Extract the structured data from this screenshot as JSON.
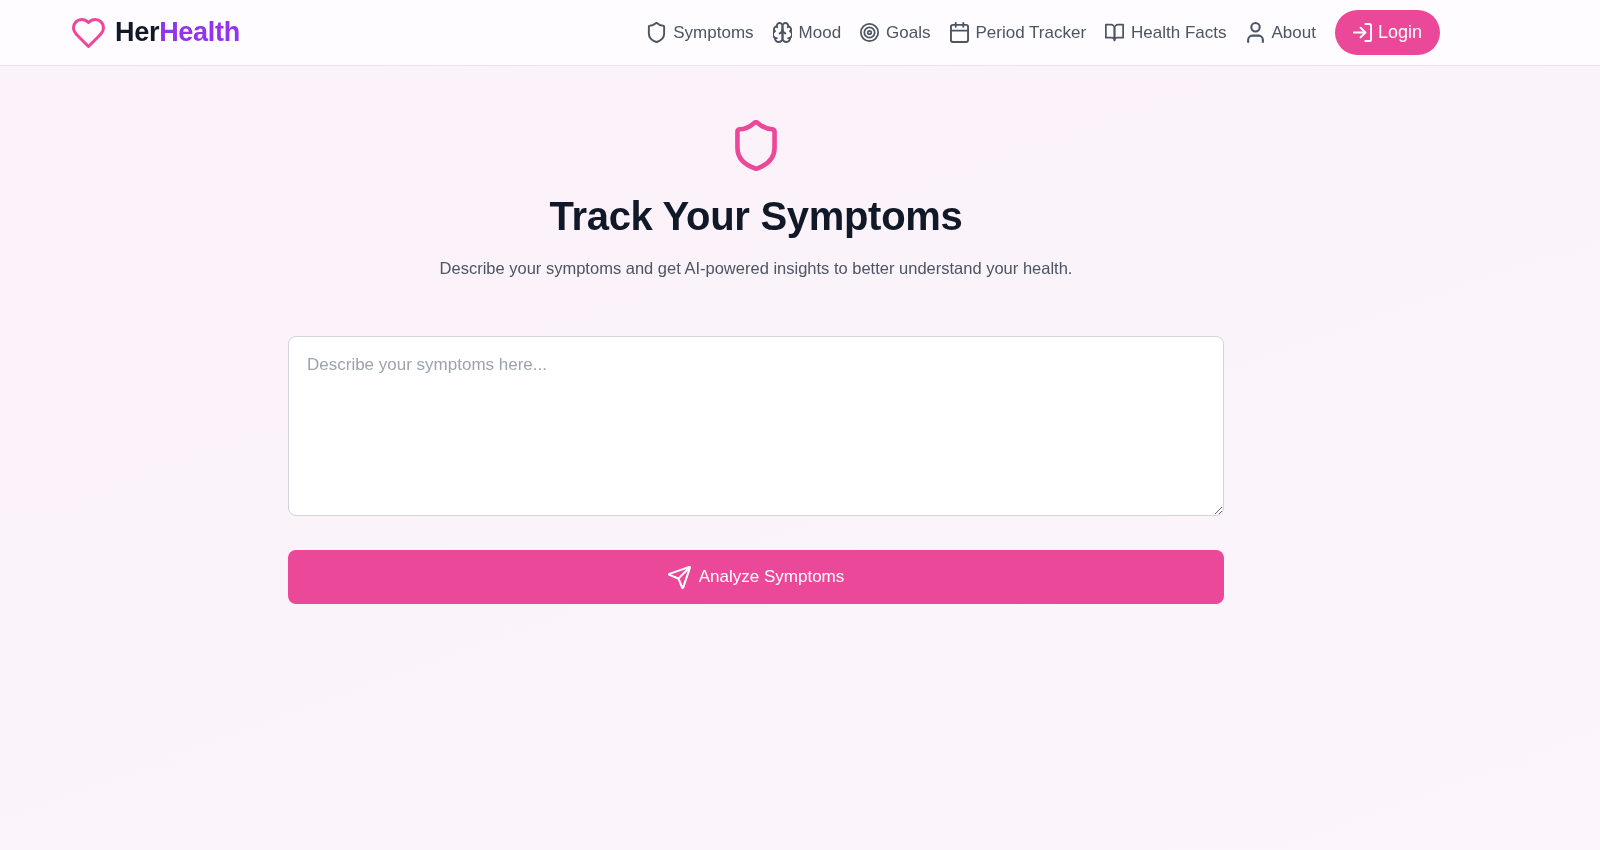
{
  "header": {
    "brand": {
      "first": "Her",
      "second": "Health"
    },
    "nav": [
      {
        "label": "Symptoms"
      },
      {
        "label": "Mood"
      },
      {
        "label": "Goals"
      },
      {
        "label": "Period Tracker"
      },
      {
        "label": "Health Facts"
      },
      {
        "label": "About"
      }
    ],
    "login_button": {
      "label": "Login"
    }
  },
  "main": {
    "title": "Track Your Symptoms",
    "subtitle": "Describe your symptoms and get AI-powered insights to better understand your health.",
    "symptoms_field": {
      "placeholder": "Describe your symptoms here..."
    },
    "analyze_button": {
      "label": "Analyze Symptoms"
    }
  }
}
